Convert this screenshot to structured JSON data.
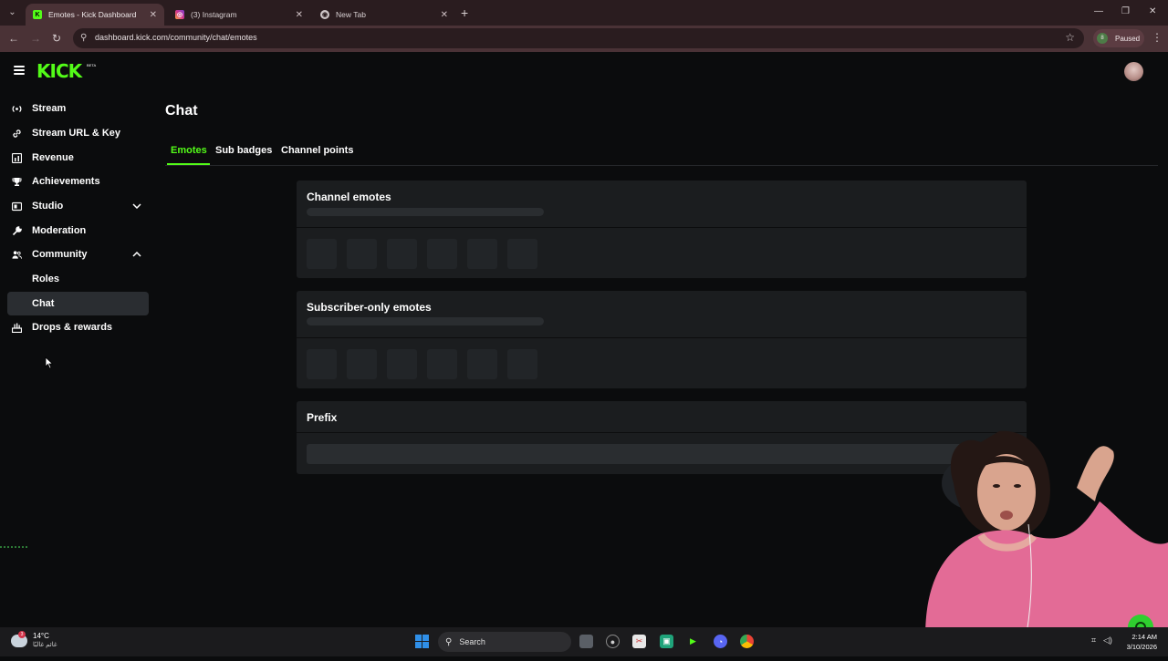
{
  "browser": {
    "tabs": [
      {
        "title": "Emotes - Kick Dashboard",
        "active": true
      },
      {
        "title": "(3) Instagram",
        "active": false
      },
      {
        "title": "New Tab",
        "active": false
      }
    ],
    "url": "dashboard.kick.com/community/chat/emotes",
    "profile_status": "Paused",
    "profile_initial": "8"
  },
  "app": {
    "logo_text": "KICK",
    "logo_badge": "BETA",
    "accent_color": "#53fc18"
  },
  "sidebar": {
    "items": [
      {
        "label": "Stream",
        "icon": "broadcast-icon"
      },
      {
        "label": "Stream URL & Key",
        "icon": "link-icon"
      },
      {
        "label": "Revenue",
        "icon": "revenue-chart-icon"
      },
      {
        "label": "Achievements",
        "icon": "trophy-icon"
      },
      {
        "label": "Studio",
        "icon": "studio-icon",
        "expanded": false
      },
      {
        "label": "Moderation",
        "icon": "wrench-icon"
      },
      {
        "label": "Community",
        "icon": "community-icon",
        "expanded": true
      },
      {
        "label": "Roles",
        "sub": true
      },
      {
        "label": "Chat",
        "sub": true,
        "selected": true
      },
      {
        "label": "Drops & rewards",
        "icon": "drops-icon"
      }
    ]
  },
  "main": {
    "title": "Chat",
    "tabs": [
      {
        "label": "Emotes",
        "active": true
      },
      {
        "label": "Sub badges",
        "active": false
      },
      {
        "label": "Channel points",
        "active": false
      }
    ],
    "sections": [
      {
        "title": "Channel emotes",
        "loading": true
      },
      {
        "title": "Subscriber-only emotes",
        "loading": true
      },
      {
        "title": "Prefix",
        "loading": true
      }
    ]
  },
  "taskbar": {
    "weather_temp": "14°C",
    "weather_condition": "غائم غالبًا",
    "weather_badge": "3",
    "search_placeholder": "Search",
    "time": "2:14 AM",
    "date": "3/10/2026"
  }
}
